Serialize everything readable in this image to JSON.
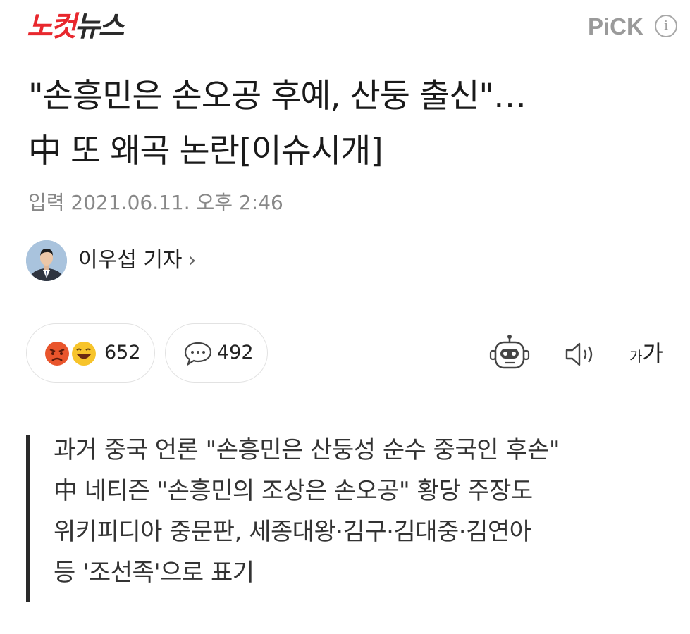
{
  "header": {
    "logo_part1": "노컷",
    "logo_part2": "뉴스",
    "pick_label": "PiCK",
    "info_icon": "i"
  },
  "article": {
    "headline_lines": [
      "\"손흥민은 손오공 후예, 산둥 출신\"…",
      "中 또 왜곡 논란[이슈시개]"
    ],
    "date": "입력 2021.06.11. 오후 2:46",
    "author": "이우섭 기자",
    "author_chevron": "›"
  },
  "actions": {
    "reaction_count": "652",
    "comment_count": "492",
    "reaction_icons": [
      "angry-emoji-icon",
      "laughing-emoji-icon"
    ],
    "comment_icon": "speech-bubble-icon",
    "tool_icons": [
      "robot-summary-icon",
      "speaker-icon"
    ],
    "font_size_small": "가",
    "font_size_big": "가"
  },
  "summary_lines": [
    "과거 중국 언론 \"손흥민은 산둥성 순수 중국인 후손\"",
    "中 네티즌 \"손흥민의 조상은 손오공\" 황당 주장도",
    "위키피디아 중문판, 세종대왕·김구·김대중·김연아",
    "등 '조선족'으로 표기"
  ],
  "colors": {
    "brand_red": "#e8282e",
    "angry_emoji": "#e9552c",
    "laugh_emoji": "#f7c42b",
    "muted_text": "#888888"
  }
}
